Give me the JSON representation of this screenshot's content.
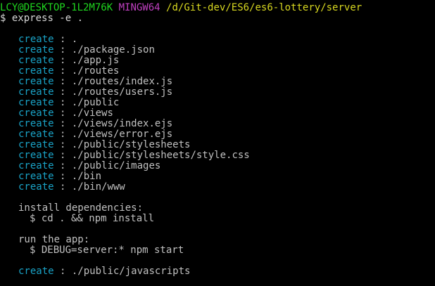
{
  "prompt": {
    "user_host": "LCY@DESKTOP-1L2M76K",
    "shell": "MINGW64",
    "path": "/d/Git-dev/ES6/es6-lottery/server",
    "symbol": "$",
    "command": "express -e ."
  },
  "create_keyword": "create",
  "separator": " : ",
  "created_files": [
    ".",
    "./package.json",
    "./app.js",
    "./routes",
    "./routes/index.js",
    "./routes/users.js",
    "./public",
    "./views",
    "./views/index.ejs",
    "./views/error.ejs",
    "./public/stylesheets",
    "./public/stylesheets/style.css",
    "./public/images",
    "./bin",
    "./bin/www"
  ],
  "install": {
    "heading": "install dependencies:",
    "command": "$ cd . && npm install"
  },
  "run": {
    "heading": "run the app:",
    "command": "$ DEBUG=server:* npm start"
  },
  "final_create": {
    "keyword": "create",
    "path": "./public/javascripts"
  },
  "colors": {
    "background": "#000000",
    "user_host": "#1fd61f",
    "shell": "#c040c0",
    "path": "#d8d820",
    "create_keyword": "#1aa3c7",
    "text": "#c0c0c0"
  }
}
